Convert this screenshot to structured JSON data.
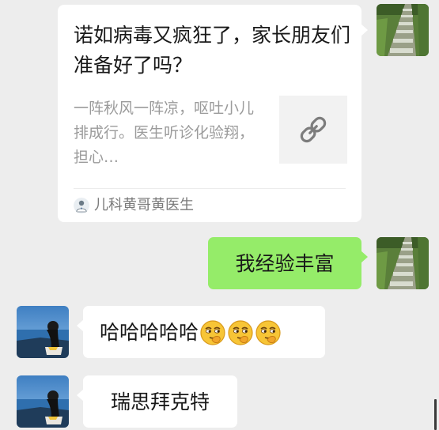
{
  "messages": {
    "link_card": {
      "title": "诺如病毒又疯狂了，家长朋友们准备好了吗？",
      "description": "一阵秋风一阵凉，呕吐小儿排成行。医生听诊化验翔，担心…",
      "source": "儿科黄哥黄医生",
      "thumbnail_icon": "link-icon",
      "direction": "outgoing"
    },
    "outgoing_text": {
      "text": "我经验丰富",
      "direction": "outgoing"
    },
    "incoming_laugh": {
      "text": "哈哈哈哈哈",
      "emoji": [
        "smirk-emoji",
        "smirk-emoji",
        "smirk-emoji"
      ],
      "direction": "incoming"
    },
    "incoming_name": {
      "text": "瑞思拜克特",
      "direction": "incoming"
    }
  },
  "colors": {
    "background": "#ededed",
    "outgoing_bubble": "#95ec69",
    "incoming_bubble": "#ffffff",
    "secondary_text": "#9b9b9b"
  }
}
